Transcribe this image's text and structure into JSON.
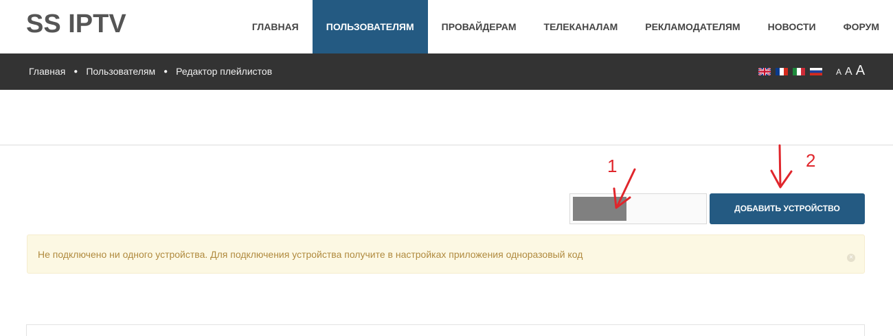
{
  "header": {
    "logo": "SS IPTV",
    "nav": [
      {
        "label": "ГЛАВНАЯ",
        "active": false
      },
      {
        "label": "ПОЛЬЗОВАТЕЛЯМ",
        "active": true
      },
      {
        "label": "ПРОВАЙДЕРАМ",
        "active": false
      },
      {
        "label": "ТЕЛЕКАНАЛАМ",
        "active": false
      },
      {
        "label": "РЕКЛАМОДАТЕЛЯМ",
        "active": false
      },
      {
        "label": "НОВОСТИ",
        "active": false
      },
      {
        "label": "ФОРУМ",
        "active": false
      }
    ]
  },
  "breadcrumb": {
    "items": [
      "Главная",
      "Пользователям",
      "Редактор плейлистов"
    ],
    "separator": "●"
  },
  "languages": [
    "english-flag-icon",
    "french-flag-icon",
    "italian-flag-icon",
    "russian-flag-icon"
  ],
  "font_sizes": [
    "A",
    "A",
    "A"
  ],
  "device_form": {
    "code_value": "",
    "button_label": "ДОБАВИТЬ УСТРОЙСТВО"
  },
  "alert": {
    "message": "Не подключено ни одного устройства. Для подключения устройства получите в настройках приложения одноразовый код",
    "close_icon": "close-icon"
  },
  "annotations": {
    "one": "1",
    "two": "2"
  },
  "colors": {
    "accent": "#245a82",
    "crumbbar": "#333333",
    "alert_bg": "#fcf8e3",
    "alert_text": "#b08a3e",
    "annotation": "#e0262c"
  }
}
